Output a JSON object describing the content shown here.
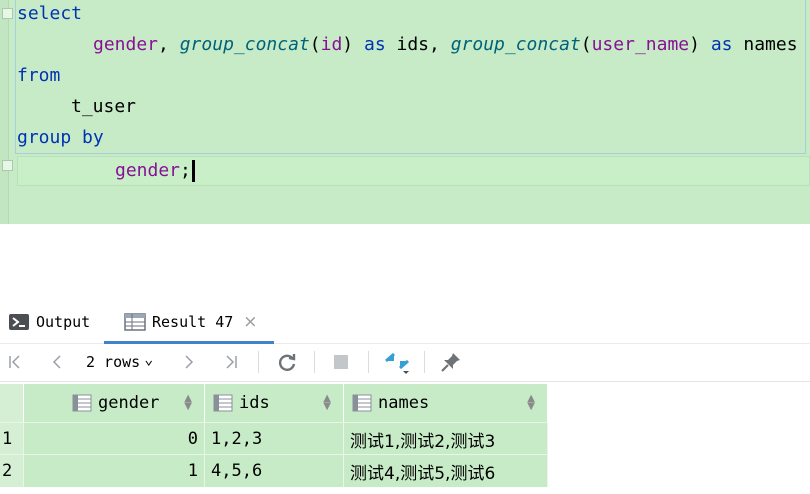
{
  "editor": {
    "lines": {
      "l1_kw": "select",
      "l2_col1": "gender",
      "l2_comma1": ", ",
      "l2_fn1": "group_concat",
      "l2_open1": "(",
      "l2_arg1": "id",
      "l2_close1": ") ",
      "l2_as1": "as",
      "l2_alias1": " ids, ",
      "l2_fn2": "group_concat",
      "l2_open2": "(",
      "l2_arg2": "user_name",
      "l2_close2": ") ",
      "l2_as2": "as",
      "l2_alias2": " names",
      "l3_kw": "from",
      "l4_table": "t_user",
      "l5_kw": "group by",
      "l6_col": "gender",
      "l6_semi": ";"
    }
  },
  "panel": {
    "tabs": {
      "output": "Output",
      "result": "Result 47",
      "close": "×"
    },
    "toolbar": {
      "rows": "2 rows",
      "rows_chevron": "⌄"
    },
    "table": {
      "columns": [
        "gender",
        "ids",
        "names"
      ],
      "rows": [
        {
          "num": "1",
          "gender": "0",
          "ids": "1,2,3",
          "names": "测试1,测试2,测试3"
        },
        {
          "num": "2",
          "gender": "1",
          "ids": "4,5,6",
          "names": "测试4,测试5,测试6"
        }
      ]
    }
  }
}
